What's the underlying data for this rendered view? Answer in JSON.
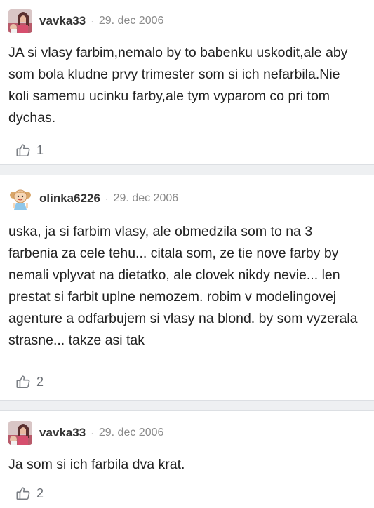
{
  "comments": [
    {
      "author": "vavka33",
      "date": "29. dec 2006",
      "text": "JA si vlasy farbim,nemalo by to babenku uskodit,ale aby som bola kludne prvy trimester som si ich nefarbila.Nie koli samemu ucinku farby,ale tym vyparom co pri tom dychas.",
      "likes": "1",
      "avatar_icon": "user-photo-avatar"
    },
    {
      "author": "olinka6226",
      "date": "29. dec 2006",
      "text": "uska, ja si farbim vlasy, ale obmedzila som to na 3 farbenia za cele tehu... citala som, ze tie nove farby by nemali vplyvat na dietatko, ale clovek nikdy nevie... len prestat si farbit uplne nemozem. robim v modelingovej agenture a odfarbujem si vlasy na blond. by som vyzerala strasne... takze asi tak",
      "likes": "2",
      "avatar_icon": "cartoon-girl-avatar"
    },
    {
      "author": "vavka33",
      "date": "29. dec 2006",
      "text": "Ja som si ich farbila dva krat.",
      "likes": "2",
      "avatar_icon": "user-photo-avatar"
    }
  ],
  "separator": "·",
  "colors": {
    "divider": "#eef0f2",
    "author": "#333333",
    "meta": "#8a8a8a",
    "like_icon": "#7a7e84"
  }
}
